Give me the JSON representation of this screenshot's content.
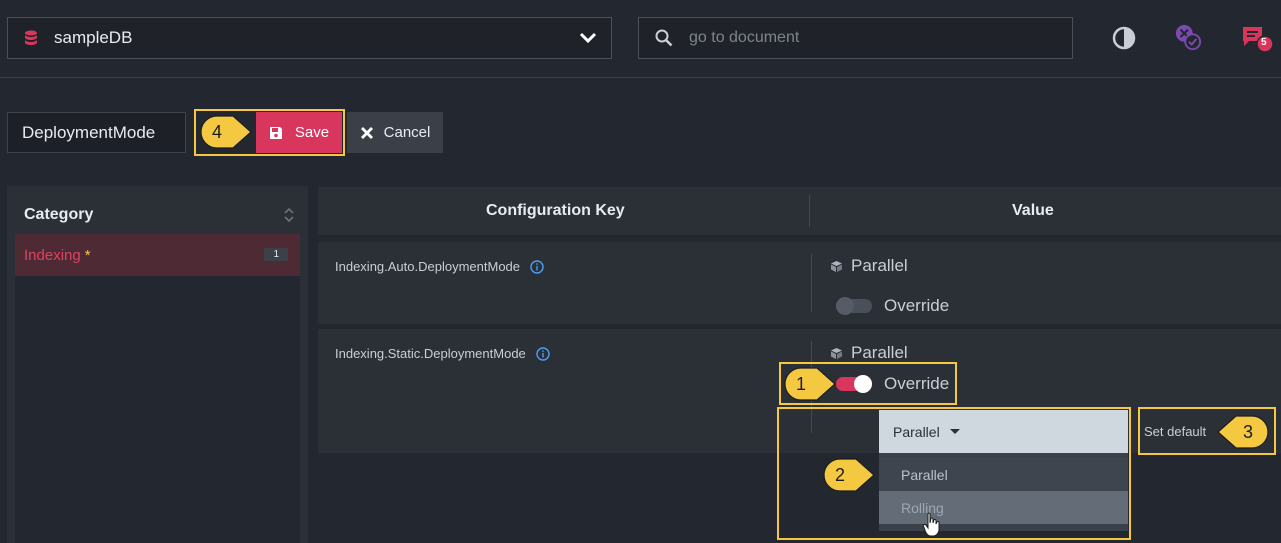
{
  "header": {
    "database": "sampleDB",
    "search_placeholder": "go to document",
    "notification_count": "5"
  },
  "toolbar": {
    "key_name": "DeploymentMode",
    "save_label": "Save",
    "cancel_label": "Cancel"
  },
  "category": {
    "title": "Category",
    "items": [
      {
        "label": "Indexing",
        "modified_mark": "*",
        "count": "1"
      }
    ]
  },
  "table": {
    "col_key": "Configuration Key",
    "col_value": "Value",
    "rows": [
      {
        "key": "Indexing.Auto.DeploymentMode",
        "value": "Parallel",
        "override_label": "Override",
        "override_on": false
      },
      {
        "key": "Indexing.Static.DeploymentMode",
        "value": "Parallel",
        "override_label": "Override",
        "override_on": true
      }
    ]
  },
  "editor": {
    "selected": "Parallel",
    "options": [
      "Parallel",
      "Rolling"
    ],
    "set_default_label": "Set default"
  },
  "callouts": [
    "1",
    "2",
    "3",
    "4"
  ],
  "colors": {
    "accent": "#d9365e",
    "highlight": "#f5c842",
    "background": "#23272f",
    "panel": "#2b3037"
  }
}
